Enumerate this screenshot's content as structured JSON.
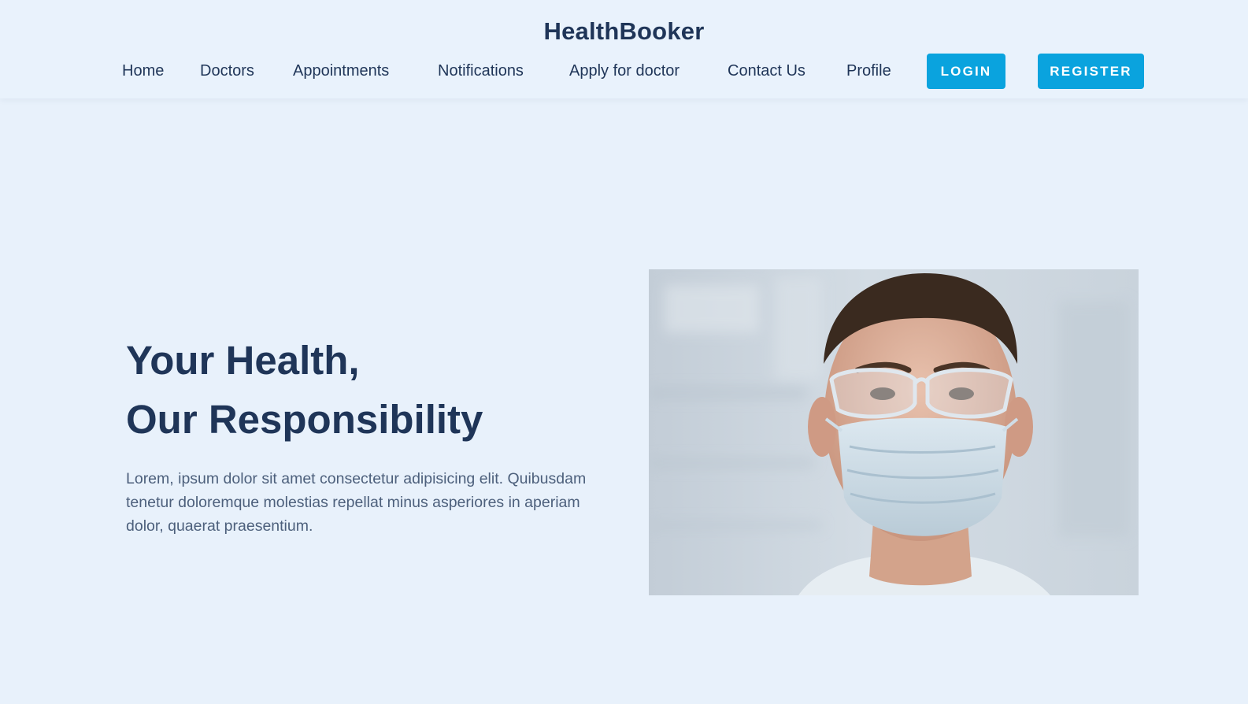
{
  "header": {
    "brand": "HealthBooker",
    "nav": [
      {
        "label": "Home"
      },
      {
        "label": "Doctors"
      },
      {
        "label": "Appointments"
      },
      {
        "label": "Notifications"
      },
      {
        "label": "Apply for doctor"
      },
      {
        "label": "Contact Us"
      },
      {
        "label": "Profile"
      }
    ],
    "login_label": "LOGIN",
    "register_label": "REGISTER"
  },
  "hero": {
    "title_line1": "Your Health,",
    "title_line2": "Our Responsibility",
    "description": "Lorem, ipsum dolor sit amet consectetur adipisicing elit. Quibusdam tenetur doloremque molestias repellat minus asperiores in aperiam dolor, quaerat praesentium."
  },
  "colors": {
    "background": "#e8f1fb",
    "text_dark": "#1f3558",
    "text_muted": "#4d607c",
    "accent": "#0aa3de"
  }
}
